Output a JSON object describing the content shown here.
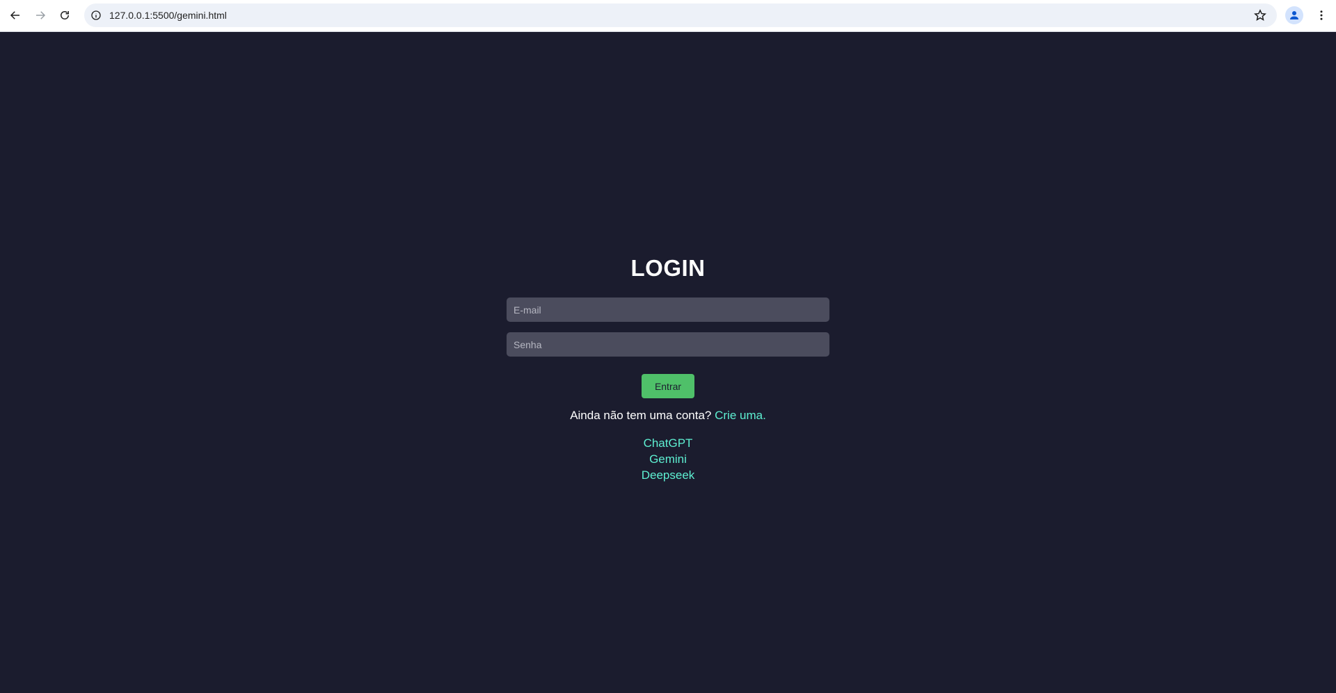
{
  "browser": {
    "url": "127.0.0.1:5500/gemini.html",
    "icons": {
      "back": "arrow-left-icon",
      "forward": "arrow-right-icon",
      "reload": "reload-icon",
      "site_info": "info-icon",
      "bookmark": "star-icon",
      "profile": "person-icon",
      "menu": "kebab-menu-icon"
    }
  },
  "login": {
    "title": "LOGIN",
    "email_placeholder": "E-mail",
    "password_placeholder": "Senha",
    "submit_label": "Entrar",
    "signup_text": "Ainda não tem uma conta?",
    "signup_link": "Crie uma.",
    "links": [
      "ChatGPT",
      "Gemini",
      "Deepseek"
    ]
  },
  "colors": {
    "background": "#1b1c2e",
    "input_bg": "#4b4c5d",
    "button_bg": "#4fc069",
    "link": "#5ef0d2",
    "text": "#ffffff"
  }
}
